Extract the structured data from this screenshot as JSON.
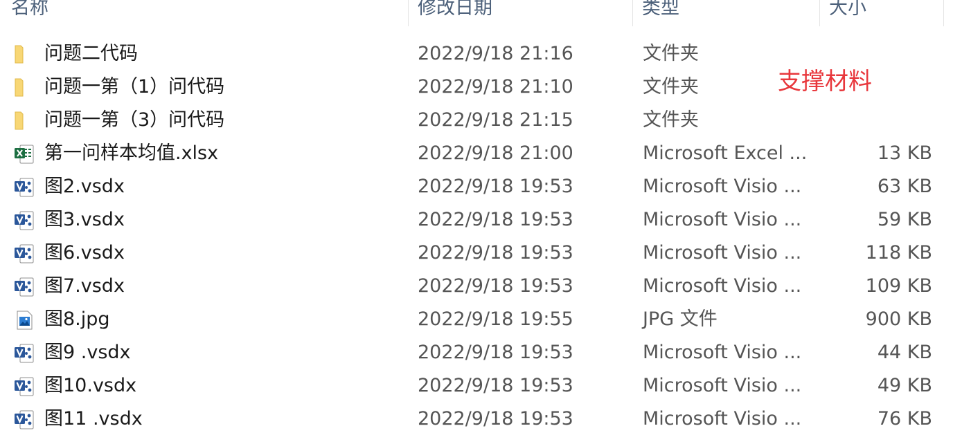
{
  "columns": {
    "name": "名称",
    "modified": "修改日期",
    "type": "类型",
    "size": "大小"
  },
  "annotation": "支撑材料",
  "files": [
    {
      "icon": "folder-icon",
      "name": "问题二代码",
      "modified": "2022/9/18 21:16",
      "type": "文件夹",
      "size": ""
    },
    {
      "icon": "folder-icon",
      "name": "问题一第（1）问代码",
      "modified": "2022/9/18 21:10",
      "type": "文件夹",
      "size": ""
    },
    {
      "icon": "folder-icon",
      "name": "问题一第（3）问代码",
      "modified": "2022/9/18 21:15",
      "type": "文件夹",
      "size": ""
    },
    {
      "icon": "excel-file-icon",
      "name": "第一问样本均值.xlsx",
      "modified": "2022/9/18 21:00",
      "type": "Microsoft Excel ...",
      "size": "13 KB"
    },
    {
      "icon": "visio-file-icon",
      "name": "图2.vsdx",
      "modified": "2022/9/18 19:53",
      "type": "Microsoft Visio ...",
      "size": "63 KB"
    },
    {
      "icon": "visio-file-icon",
      "name": "图3.vsdx",
      "modified": "2022/9/18 19:53",
      "type": "Microsoft Visio ...",
      "size": "59 KB"
    },
    {
      "icon": "visio-file-icon",
      "name": "图6.vsdx",
      "modified": "2022/9/18 19:53",
      "type": "Microsoft Visio ...",
      "size": "118 KB"
    },
    {
      "icon": "visio-file-icon",
      "name": "图7.vsdx",
      "modified": "2022/9/18 19:53",
      "type": "Microsoft Visio ...",
      "size": "109 KB"
    },
    {
      "icon": "image-file-icon",
      "name": "图8.jpg",
      "modified": "2022/9/18 19:55",
      "type": "JPG 文件",
      "size": "900 KB"
    },
    {
      "icon": "visio-file-icon",
      "name": "图9 .vsdx",
      "modified": "2022/9/18 19:53",
      "type": "Microsoft Visio ...",
      "size": "44 KB"
    },
    {
      "icon": "visio-file-icon",
      "name": "图10.vsdx",
      "modified": "2022/9/18 19:53",
      "type": "Microsoft Visio ...",
      "size": "49 KB"
    },
    {
      "icon": "visio-file-icon",
      "name": "图11 .vsdx",
      "modified": "2022/9/18 19:53",
      "type": "Microsoft Visio ...",
      "size": "76 KB"
    }
  ],
  "colors": {
    "header_text": "#4c607a",
    "annotation": "#e8373c",
    "folder": "#f8d775",
    "excel": "#1d6f42",
    "visio": "#2b579a",
    "image": "#2d7dd2"
  }
}
